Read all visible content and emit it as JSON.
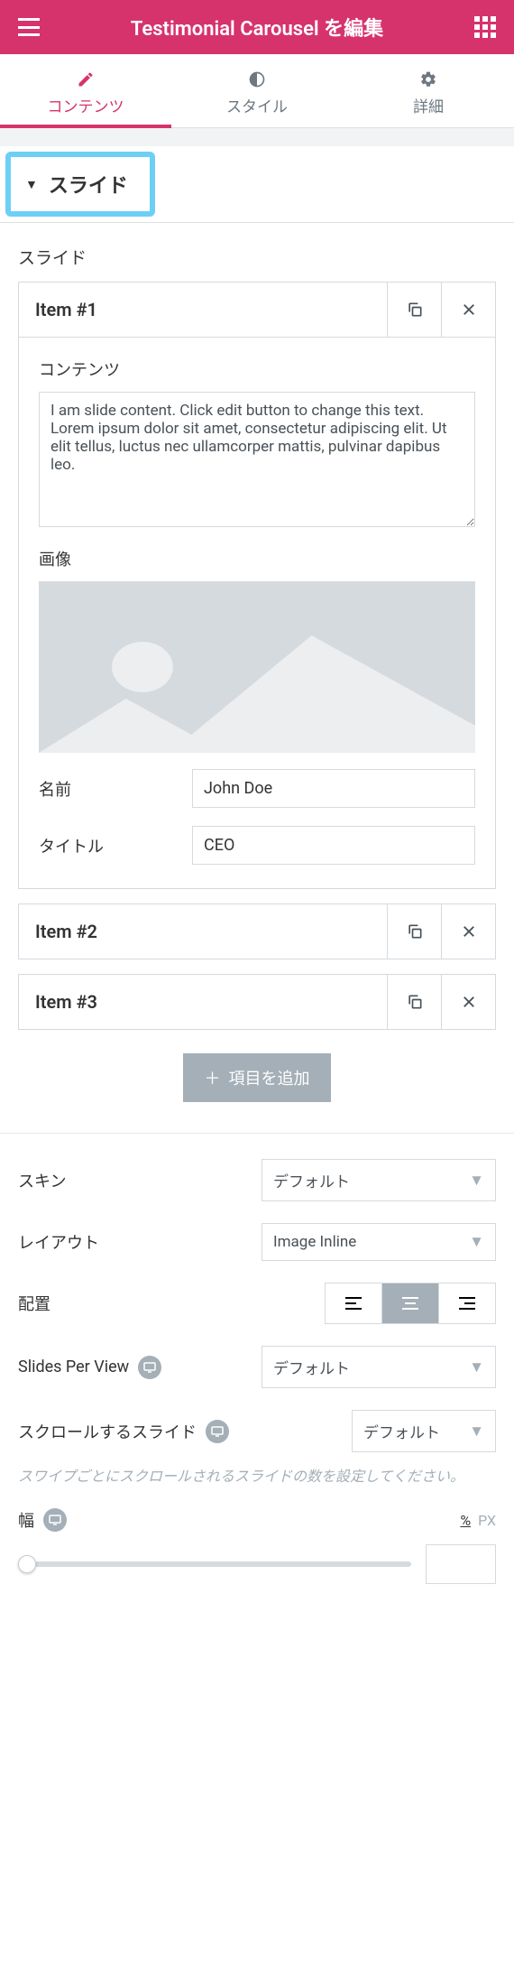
{
  "header": {
    "title": "Testimonial Carousel を編集"
  },
  "tabs": {
    "content": "コンテンツ",
    "style": "スタイル",
    "advanced": "詳細"
  },
  "section": {
    "slides": "スライド"
  },
  "slides": {
    "label": "スライド",
    "items": [
      {
        "title": "Item #1",
        "content_label": "コンテンツ",
        "content": "I am slide content. Click edit button to change this text. Lorem ipsum dolor sit amet, consectetur adipiscing elit. Ut elit tellus, luctus nec ullamcorper mattis, pulvinar dapibus leo.",
        "image_label": "画像",
        "name_label": "名前",
        "name": "John Doe",
        "title_label": "タイトル",
        "title_val": "CEO"
      },
      {
        "title": "Item #2"
      },
      {
        "title": "Item #3"
      }
    ],
    "add": "項目を追加"
  },
  "controls": {
    "skin": {
      "label": "スキン",
      "value": "デフォルト"
    },
    "layout": {
      "label": "レイアウト",
      "value": "Image Inline"
    },
    "alignment": {
      "label": "配置"
    },
    "slides_per_view": {
      "label": "Slides Per View",
      "value": "デフォルト"
    },
    "slides_to_scroll": {
      "label": "スクロールするスライド",
      "value": "デフォルト",
      "help": "スワイプごとにスクロールされるスライドの数を設定してください。"
    },
    "width": {
      "label": "幅",
      "unit_pct": "%",
      "unit_px": "PX"
    }
  }
}
